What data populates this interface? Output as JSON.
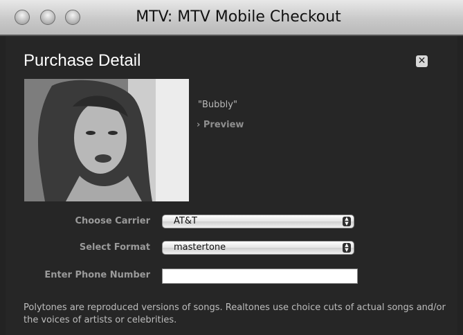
{
  "window": {
    "title": "MTV: MTV Mobile Checkout"
  },
  "page": {
    "title": "Purchase Detail",
    "close_glyph": "✕",
    "song_title": "\"Bubbly\"",
    "preview_label": "Preview",
    "preview_glyph": "›"
  },
  "form": {
    "carrier_label": "Choose Carrier",
    "carrier_value": "AT&T",
    "format_label": "Select Format",
    "format_value": "mastertone",
    "phone_label": "Enter Phone Number",
    "phone_value": ""
  },
  "note": "Polytones are reproduced versions of songs. Realtones use choice cuts of actual songs and/or the voices of artists or celebrities.",
  "icons": {
    "close": "close-icon",
    "preview": "chevron-right-icon",
    "select": "updown-arrows-icon"
  }
}
